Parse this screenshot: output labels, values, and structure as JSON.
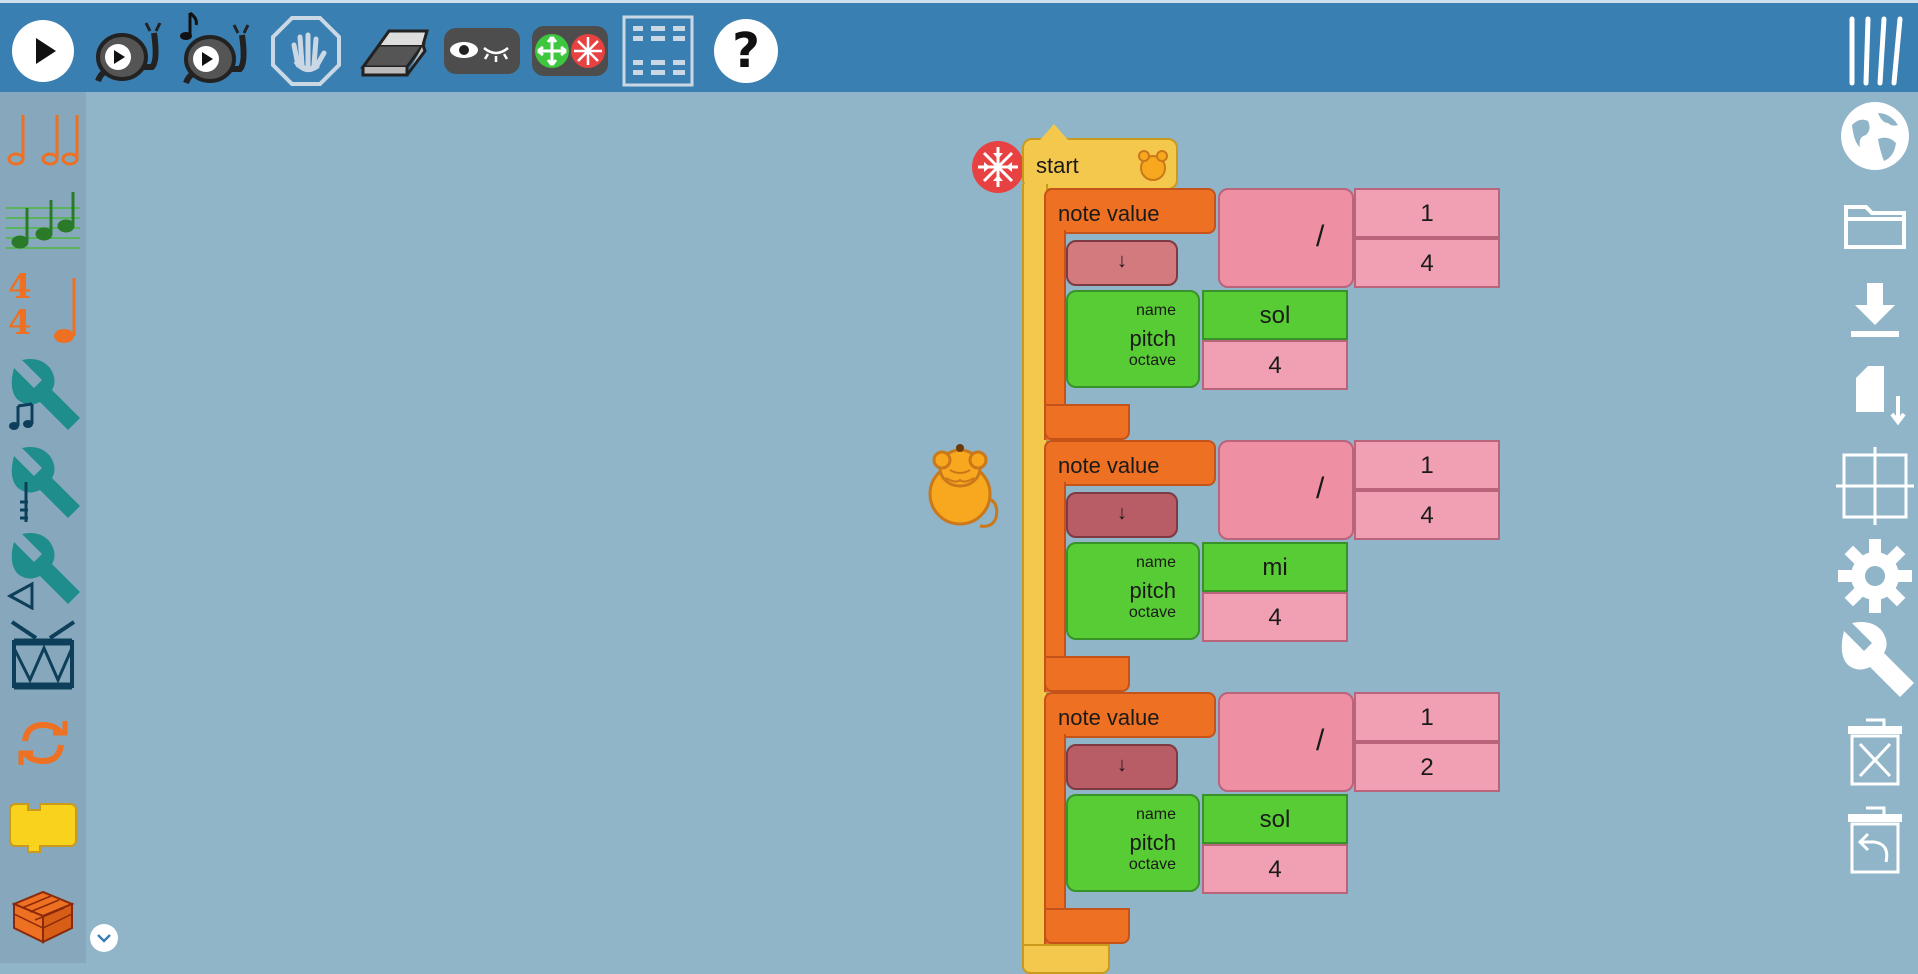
{
  "toolbar": {
    "buttons": [
      {
        "name": "play-button",
        "icon": "play-icon"
      },
      {
        "name": "run-slow-button",
        "icon": "snail-play-icon"
      },
      {
        "name": "run-step-button",
        "icon": "snail-note-play-icon"
      },
      {
        "name": "stop-button",
        "icon": "stop-hand-icon"
      },
      {
        "name": "clear-button",
        "icon": "eraser-icon"
      },
      {
        "name": "show-hide-blocks-button",
        "icon": "eye-icon"
      },
      {
        "name": "expand-collapse-button",
        "icon": "expand-collapse-icon"
      },
      {
        "name": "grid-button",
        "icon": "grid-icon"
      },
      {
        "name": "help-button",
        "icon": "question-icon",
        "label": "?"
      }
    ],
    "menu_icon": "hamburger-vertical-icon"
  },
  "palette": [
    {
      "name": "rhythm",
      "icon": "rhythm-notes-icon"
    },
    {
      "name": "pitch",
      "icon": "staff-notes-icon"
    },
    {
      "name": "meter",
      "icon": "meter-icon",
      "label": "4"
    },
    {
      "name": "intervals",
      "icon": "wrench-music-icon"
    },
    {
      "name": "tone",
      "icon": "wrench-tone-icon"
    },
    {
      "name": "volume",
      "icon": "wrench-volume-icon"
    },
    {
      "name": "drum",
      "icon": "drum-icon"
    },
    {
      "name": "flow",
      "icon": "repeat-icon"
    },
    {
      "name": "action",
      "icon": "action-block-icon"
    },
    {
      "name": "boxes",
      "icon": "box-icon"
    }
  ],
  "rightbar": [
    {
      "name": "language-button",
      "icon": "globe-icon"
    },
    {
      "name": "open-button",
      "icon": "folder-icon"
    },
    {
      "name": "save-button",
      "icon": "download-icon"
    },
    {
      "name": "export-button",
      "icon": "file-download-icon"
    },
    {
      "name": "grid-toggle-button",
      "icon": "crosshair-grid-icon"
    },
    {
      "name": "settings-button",
      "icon": "gear-icon"
    },
    {
      "name": "tools-button",
      "icon": "wrench-icon"
    },
    {
      "name": "delete-button",
      "icon": "trash-icon"
    },
    {
      "name": "restore-button",
      "icon": "restore-trash-icon"
    }
  ],
  "program": {
    "start_label": "start",
    "notes": [
      {
        "label": "note value",
        "numerator": "1",
        "denominator": "4",
        "divide": "/",
        "arrow": "↓",
        "pitch_label": "pitch",
        "name_label": "name",
        "octave_label": "octave",
        "name": "sol",
        "octave": "4"
      },
      {
        "label": "note value",
        "numerator": "1",
        "denominator": "4",
        "divide": "/",
        "arrow": "↓",
        "pitch_label": "pitch",
        "name_label": "name",
        "octave_label": "octave",
        "name": "mi",
        "octave": "4"
      },
      {
        "label": "note value",
        "numerator": "1",
        "denominator": "2",
        "divide": "/",
        "arrow": "↓",
        "pitch_label": "pitch",
        "name_label": "name",
        "octave_label": "octave",
        "name": "sol",
        "octave": "4"
      }
    ]
  },
  "colors": {
    "toolbar": "#3a7fb1",
    "canvas": "#90b4c8",
    "start_block": "#f4c84d",
    "note_block": "#ee7022",
    "pitch_block": "#58cc34",
    "number_block": "#ee8fa4"
  }
}
